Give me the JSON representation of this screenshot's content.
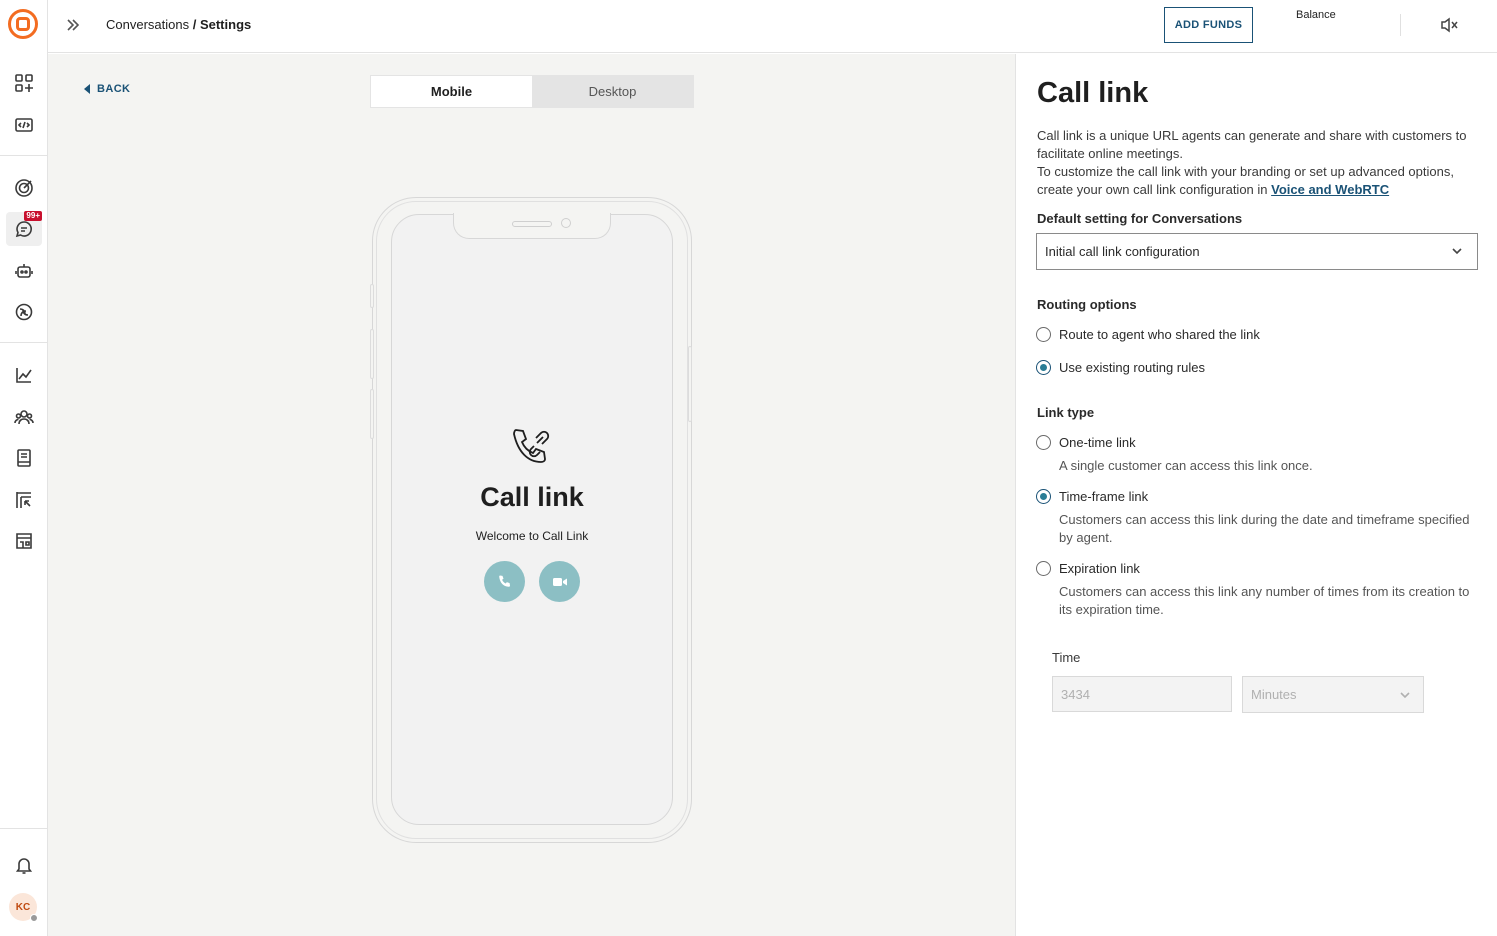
{
  "header": {
    "breadcrumb_parent": "Conversations",
    "breadcrumb_sep": " / ",
    "breadcrumb_current": "Settings",
    "add_funds_label": "ADD FUNDS",
    "balance_label": "Balance"
  },
  "sidebar": {
    "items": [
      {
        "icon": "apps-icon"
      },
      {
        "icon": "code-icon"
      },
      {
        "icon": "target-icon"
      },
      {
        "icon": "chat-icon",
        "badge": "99+",
        "active": true
      },
      {
        "icon": "bot-icon"
      },
      {
        "icon": "ai-icon"
      },
      {
        "icon": "analytics-icon"
      },
      {
        "icon": "people-icon"
      },
      {
        "icon": "book-icon"
      },
      {
        "icon": "exchange-icon"
      },
      {
        "icon": "store-icon"
      }
    ],
    "avatar_initials": "KC"
  },
  "preview": {
    "back_label": "BACK",
    "tabs": [
      {
        "label": "Mobile",
        "active": true
      },
      {
        "label": "Desktop",
        "active": false
      }
    ],
    "phone_title": "Call link",
    "phone_subtitle": "Welcome to Call Link"
  },
  "panel": {
    "title": "Call link",
    "desc_line1": "Call link is a unique URL agents can generate and share with customers to facilitate online meetings.",
    "desc_line2": "To customize the call link with your branding or set up advanced options, create your own call link configuration in ",
    "desc_link": "Voice and WebRTC",
    "default_setting_label": "Default setting for Conversations",
    "default_setting_value": "Initial call link configuration",
    "routing_label": "Routing options",
    "routing_options": [
      {
        "label": "Route to agent who shared the link",
        "selected": false
      },
      {
        "label": "Use existing routing rules",
        "selected": true
      }
    ],
    "link_type_label": "Link type",
    "link_types": [
      {
        "label": "One-time link",
        "help": "A single customer can access this link once.",
        "selected": false
      },
      {
        "label": "Time-frame link",
        "help": "Customers can access this link during the date and timeframe specified by agent.",
        "selected": true
      },
      {
        "label": "Expiration link",
        "help": "Customers can access this link any number of times from its creation to its expiration time.",
        "selected": false
      }
    ],
    "time_label": "Time",
    "time_value": "3434",
    "time_unit": "Minutes"
  },
  "colors": {
    "brand_orange": "#f36c21",
    "primary_blue": "#1a5276",
    "radio_teal": "#2a7d96",
    "call_button": "#8cbfc4",
    "badge_red": "#c8102e"
  }
}
